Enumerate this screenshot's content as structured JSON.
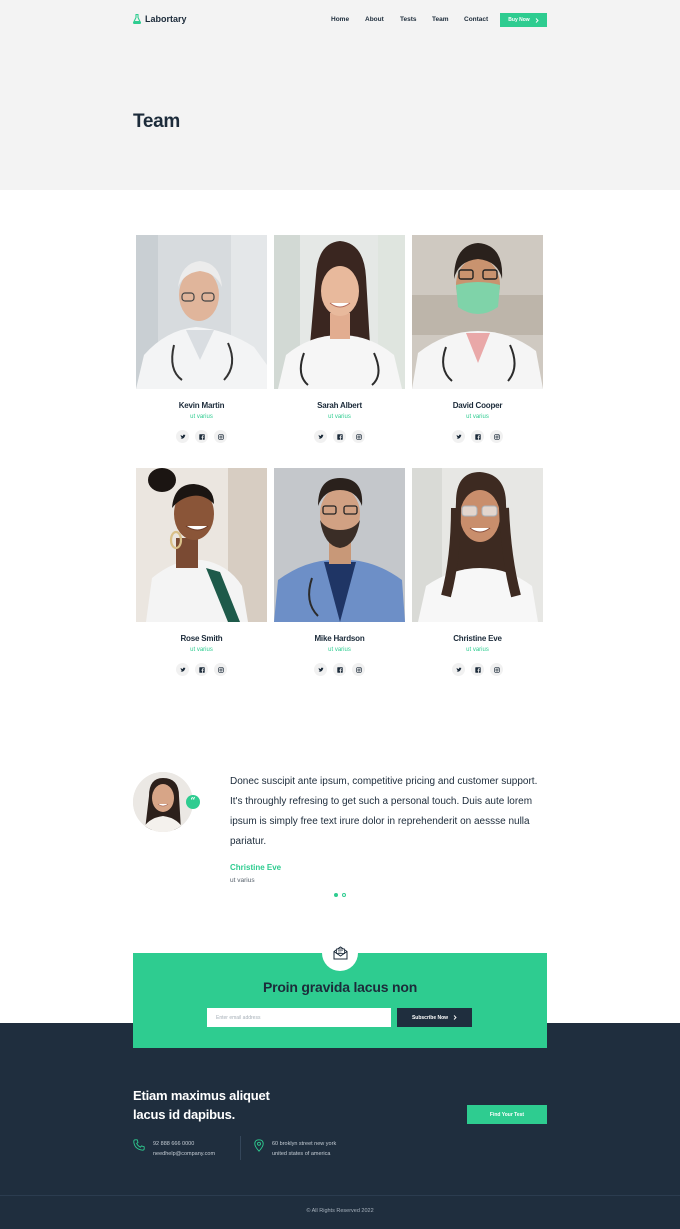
{
  "brand": {
    "name": "Labortary",
    "accent": "#2ecc90",
    "dark": "#1f2e3e"
  },
  "nav": {
    "items": [
      "Home",
      "About",
      "Tests",
      "Team",
      "Contact"
    ],
    "cta": "Buy Now"
  },
  "hero": {
    "title": "Team"
  },
  "team": [
    {
      "name": "Kevin Martin",
      "role": "ut varius"
    },
    {
      "name": "Sarah Albert",
      "role": "ut varius"
    },
    {
      "name": "David Cooper",
      "role": "ut varius"
    },
    {
      "name": "Rose Smith",
      "role": "ut varius"
    },
    {
      "name": "Mike Hardson",
      "role": "ut varius"
    },
    {
      "name": "Christine Eve",
      "role": "ut varius"
    }
  ],
  "social_icons": [
    "twitter-icon",
    "facebook-icon",
    "instagram-icon"
  ],
  "testimonial": {
    "quote": "Donec suscipit ante ipsum, competitive pricing and customer support. It's throughly refresing to get such a personal touch. Duis aute lorem ipsum is simply free text irure dolor in reprehenderit on aessse nulla pariatur.",
    "name": "Christine Eve",
    "role": "ut varius",
    "badge": "“",
    "slides": 2,
    "active_slide": 1
  },
  "newsletter": {
    "title": "Proin gravida lacus non",
    "placeholder": "Enter email address",
    "button": "Subscribe Now"
  },
  "footer": {
    "heading_line1": "Etiam maximus aliquet",
    "heading_line2": "lacus id dapibus.",
    "button": "Find Your Test",
    "phone": "92 888 666 0000",
    "email": "needhelp@company.com",
    "address_line1": "60 broklyn street new york",
    "address_line2": "united states of america",
    "copyright": "© All Rights Reserved 2022"
  }
}
